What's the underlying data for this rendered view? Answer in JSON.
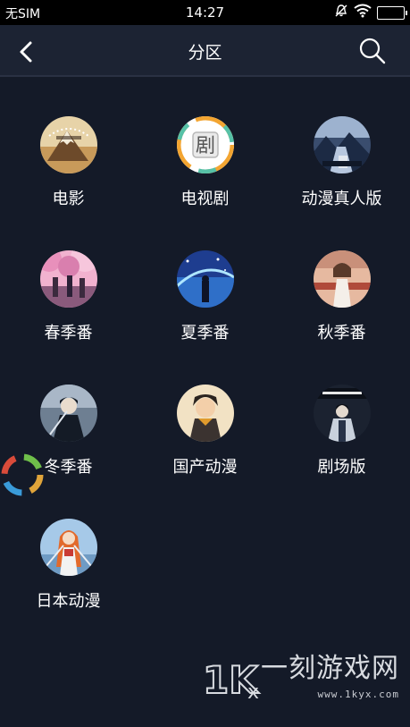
{
  "status_bar": {
    "carrier": "无SIM",
    "time": "14:27"
  },
  "nav": {
    "title": "分区",
    "back_icon": "chevron-left-icon",
    "search_icon": "search-icon"
  },
  "categories": [
    {
      "label": "电影",
      "icon": "mountain-logo"
    },
    {
      "label": "电视剧",
      "icon": "drama-logo"
    },
    {
      "label": "动漫真人版",
      "icon": "anime-poster"
    },
    {
      "label": "春季番",
      "icon": "cherry-blossom"
    },
    {
      "label": "夏季番",
      "icon": "starry-sky"
    },
    {
      "label": "秋季番",
      "icon": "autumn-girl"
    },
    {
      "label": "冬季番",
      "icon": "swordsman"
    },
    {
      "label": "国产动漫",
      "icon": "chinese-hero"
    },
    {
      "label": "剧场版",
      "icon": "movie-poster"
    },
    {
      "label": "日本动漫",
      "icon": "swordswoman"
    }
  ],
  "watermark": {
    "brand": "一刻游戏网",
    "url": "www.1kyx.com",
    "logo_text": "1KYX"
  }
}
